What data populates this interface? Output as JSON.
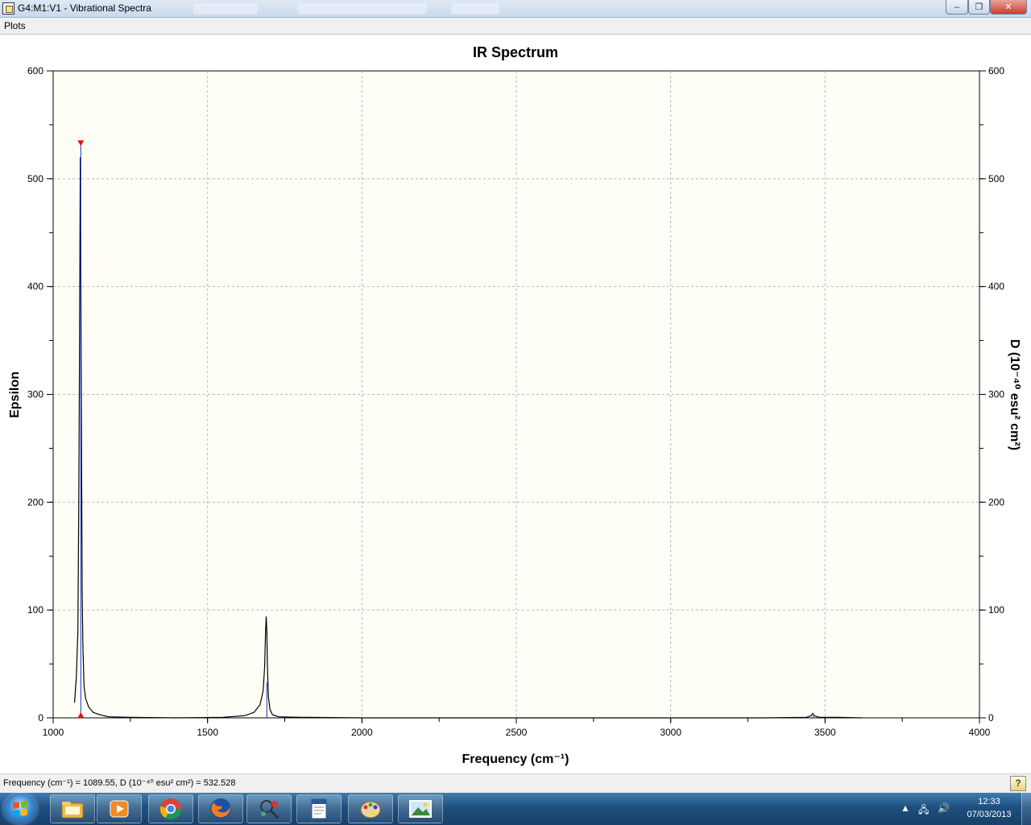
{
  "window": {
    "title": "G4:M1:V1 - Vibrational Spectra",
    "minimize_label": "–",
    "maximize_label": "❐",
    "close_label": "✕"
  },
  "menu": {
    "items": [
      {
        "label": "Plots"
      }
    ]
  },
  "chart_data": {
    "type": "line",
    "title": "IR Spectrum",
    "xlabel": "Frequency (cm⁻¹)",
    "ylabel": "Epsilon",
    "y2label": "D (10⁻⁴⁰ esu² cm²)",
    "xlim": [
      1000,
      4000
    ],
    "ylim": [
      0,
      600
    ],
    "y2lim": [
      0,
      600
    ],
    "x_ticks": [
      "1000",
      "1500",
      "2000",
      "2500",
      "3000",
      "3500",
      "4000"
    ],
    "y_ticks": [
      "0",
      "100",
      "200",
      "300",
      "400",
      "500",
      "600"
    ],
    "y2_ticks": [
      "0",
      "100",
      "200",
      "300",
      "400",
      "500",
      "600"
    ],
    "grid": true,
    "series": [
      {
        "x": [
          1069,
          1075,
          1080,
          1083,
          1085,
          1087,
          1088,
          1089,
          1090,
          1091,
          1092,
          1094,
          1096,
          1100,
          1105,
          1115,
          1130,
          1150,
          1180,
          1250,
          1400,
          1550,
          1620,
          1650,
          1670,
          1680,
          1685,
          1688,
          1690,
          1692,
          1694,
          1697,
          1702,
          1710,
          1730,
          1800,
          2000,
          2500,
          3000,
          3300,
          3440,
          3455,
          3460,
          3465,
          3480,
          3540,
          3620
        ],
        "values": [
          14,
          38,
          80,
          200,
          320,
          445,
          520,
          450,
          400,
          300,
          233,
          120,
          70,
          30,
          18,
          10,
          5,
          3,
          1,
          0.5,
          0,
          0.5,
          2,
          5,
          12,
          25,
          48,
          80,
          94,
          80,
          48,
          20,
          8,
          3,
          1,
          0.5,
          0,
          0,
          0,
          0,
          0.5,
          2,
          4,
          2,
          0.5,
          0.5,
          0
        ]
      }
    ],
    "sticks": [
      {
        "x": 1089.55,
        "value": 532.528,
        "selected": true
      },
      {
        "x": 1692,
        "value": 33
      },
      {
        "x": 3462,
        "value": 2
      }
    ],
    "colors": {
      "line": "#000000",
      "stick": "#1a2dbf",
      "marker": "#e01010",
      "plot_bg": "#fefef6",
      "grid": "#b8b8b8"
    }
  },
  "status": {
    "text": "Frequency (cm⁻¹) = 1089.55, D (10⁻⁴⁰ esu² cm²) = 532.528",
    "help_label": "?"
  },
  "taskbar": {
    "apps": [
      {
        "name": "windows-explorer"
      },
      {
        "name": "media-player"
      },
      {
        "name": "chrome"
      },
      {
        "name": "firefox"
      },
      {
        "name": "gaussview"
      },
      {
        "name": "word-processor"
      },
      {
        "name": "paint"
      },
      {
        "name": "photo-viewer"
      }
    ],
    "clock_time": "12:33",
    "clock_date": "07/03/2013"
  }
}
